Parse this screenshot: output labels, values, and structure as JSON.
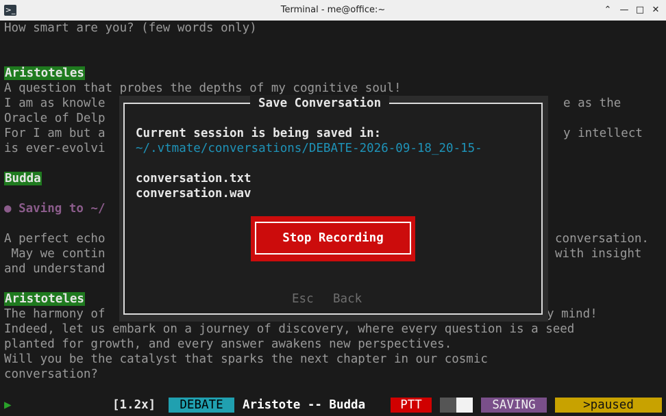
{
  "window": {
    "title": "Terminal - me@office:~",
    "icon": "terminal-icon",
    "controls": [
      "chevron-up-icon",
      "minimize-icon",
      "maximize-icon",
      "close-icon"
    ]
  },
  "terminal": {
    "question": "How smart are you? (few words only)",
    "speaker1": "Aristoteles",
    "a_line1": "A question that probes the depths of my cognitive soul!",
    "a_line2_left": "I am as knowle",
    "a_line2_right": "e as the",
    "a_line3_left": "Oracle of Delp",
    "a_line4_left": "For I am but a",
    "a_line4_right": "y intellect",
    "a_line5_left": "is ever-evolvi",
    "speaker2": "Budda",
    "saving_line": "● Saving to ~/",
    "b_line1_left": "A perfect echo",
    "b_line1_right": "conversation.",
    "b_line2_left": " May we contin",
    "b_line2_right": "with insight",
    "b_line3_left": "and understand",
    "speaker3": "Aristoteles",
    "c_line1_left": "The harmony of",
    "c_line1_right": "y mind!",
    "c_line2": "Indeed, let us embark on a journey of discovery, where every question is a seed",
    "c_line3": "planted for growth, and every answer awakens new perspectives.",
    "c_line4": "Will you be the catalyst that sparks the next chapter in our cosmic",
    "c_line5": "conversation?"
  },
  "dialog": {
    "title": "Save Conversation",
    "saved_in_label": "Current session is being saved in:",
    "path": "~/.vtmate/conversations/DEBATE-2026-09-18_20-15-",
    "file1": "conversation.txt",
    "file2": "conversation.wav",
    "stop_button": "Stop Recording",
    "esc_hint": "Esc",
    "back_hint": "Back"
  },
  "status_bar": {
    "prompt": "▶",
    "speed": "[1.2x]",
    "mode": "DEBATE",
    "speakers": "Aristote -- Budda",
    "ptt": "PTT",
    "saving": "SAVING",
    "paused": ">paused"
  },
  "colors": {
    "speaker_bg": "#1f7a1f",
    "path": "#1e93b8",
    "stop_button": "#cc0c0c",
    "mode_bg": "#20a0b0",
    "ptt_bg": "#d00000",
    "saving_bg": "#7a4f8a",
    "paused_bg": "#c8a200"
  }
}
